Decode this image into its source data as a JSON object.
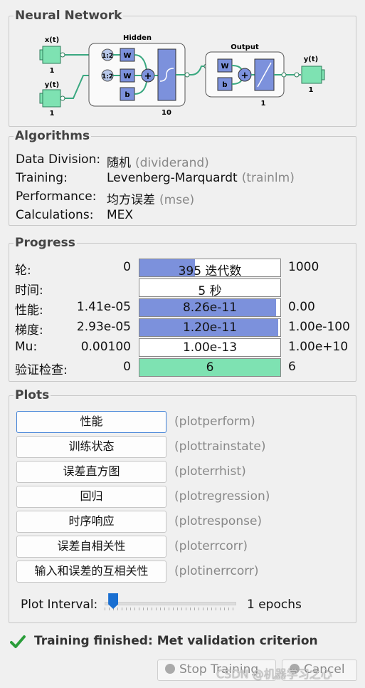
{
  "neural_network": {
    "title": "Neural Network",
    "inputs": [
      "x(t)",
      "y(t)"
    ],
    "input_sizes": [
      "1",
      "1"
    ],
    "hidden_title": "Hidden",
    "hidden_size": "10",
    "output_title": "Output",
    "output_size": "1",
    "output_label": "y(t)",
    "output_label_size": "1",
    "delay_label": "1:2",
    "weight_label": "W",
    "bias_label": "b",
    "plus_label": "+"
  },
  "algorithms": {
    "title": "Algorithms",
    "rows": [
      {
        "label": "Data Division:",
        "value": "随机",
        "detail": "(dividerand)"
      },
      {
        "label": "Training:",
        "value": "Levenberg-Marquardt",
        "detail": "(trainlm)"
      },
      {
        "label": "Performance:",
        "value": "均方误差",
        "detail": "(mse)"
      },
      {
        "label": "Calculations:",
        "value": "MEX",
        "detail": ""
      }
    ]
  },
  "progress": {
    "title": "Progress",
    "rows": [
      {
        "label": "轮:",
        "min": "0",
        "value": "395 迭代数",
        "max": "1000",
        "fill": 0.395
      },
      {
        "label": "时间:",
        "min": "",
        "value": "5 秒",
        "max": "",
        "fill": 0
      },
      {
        "label": "性能:",
        "min": "1.41e-05",
        "value": "8.26e-11",
        "max": "0.00",
        "fill": 0.97
      },
      {
        "label": "梯度:",
        "min": "2.93e-05",
        "value": "1.20e-11",
        "max": "1.00e-100",
        "fill": 0.985
      },
      {
        "label": "Mu:",
        "min": "0.00100",
        "value": "1.00e-13",
        "max": "1.00e+10",
        "fill": 0
      },
      {
        "label": "验证检查:",
        "min": "0",
        "value": "6",
        "max": "6",
        "fill": 1.0
      }
    ]
  },
  "plots": {
    "title": "Plots",
    "buttons": [
      {
        "label": "性能",
        "fn": "(plotperform)"
      },
      {
        "label": "训练状态",
        "fn": "(plottrainstate)"
      },
      {
        "label": "误差直方图",
        "fn": "(ploterrhist)"
      },
      {
        "label": "回归",
        "fn": "(plotregression)"
      },
      {
        "label": "时序响应",
        "fn": "(plotresponse)"
      },
      {
        "label": "误差自相关性",
        "fn": "(ploterrcorr)"
      },
      {
        "label": "输入和误差的互相关性",
        "fn": "(plotinerrcorr)"
      }
    ],
    "interval_label": "Plot Interval:",
    "interval_value": "1 epochs",
    "interval_fraction": 0.03
  },
  "status": {
    "message": "Training finished: Met validation criterion",
    "color": "#2a9d3a"
  },
  "footer": {
    "stop_label": "Stop Training",
    "cancel_label": "Cancel",
    "watermark": "CSDN @机器学习之心"
  },
  "colors": {
    "block_green": "#7ee2b2",
    "block_blue": "#7c91dc",
    "progress_blue": "#7c91dc",
    "progress_green": "#7ee2b2"
  }
}
